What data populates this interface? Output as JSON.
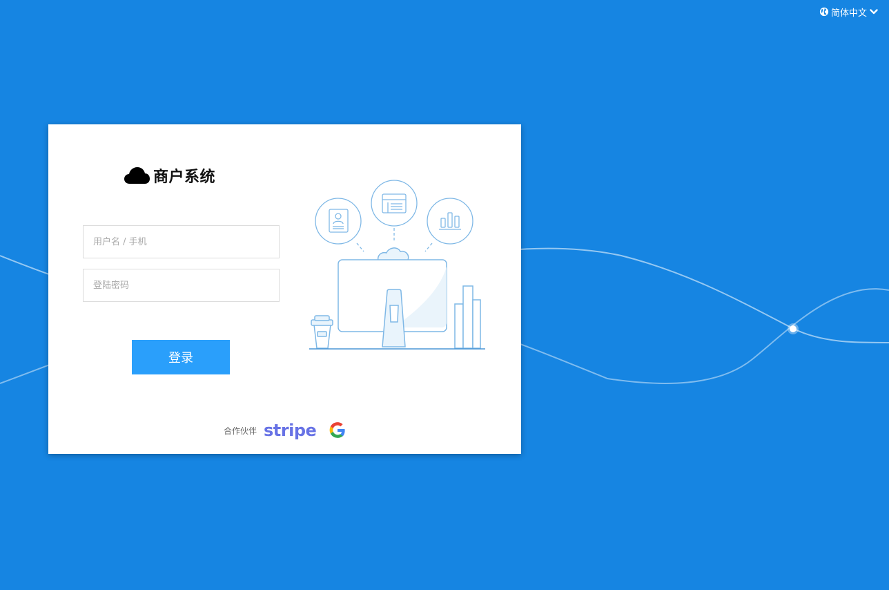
{
  "header": {
    "language_label": "简体中文",
    "language_icon": "globe-icon",
    "dropdown_icon": "chevron-down-icon"
  },
  "login": {
    "brand_title": "商户系统",
    "brand_icon": "cloud-icon",
    "username_placeholder": "用户名 / 手机",
    "username_value": "",
    "password_placeholder": "登陆密码",
    "password_value": "",
    "submit_label": "登录"
  },
  "partners": {
    "label": "合作伙伴",
    "items": [
      {
        "name": "stripe",
        "text": "stripe"
      },
      {
        "name": "google",
        "icon": "google-logo"
      }
    ]
  },
  "colors": {
    "background": "#1685e2",
    "button": "#2a9ffb",
    "stripe": "#6772e5",
    "illustration_line": "#7fb8e6"
  }
}
